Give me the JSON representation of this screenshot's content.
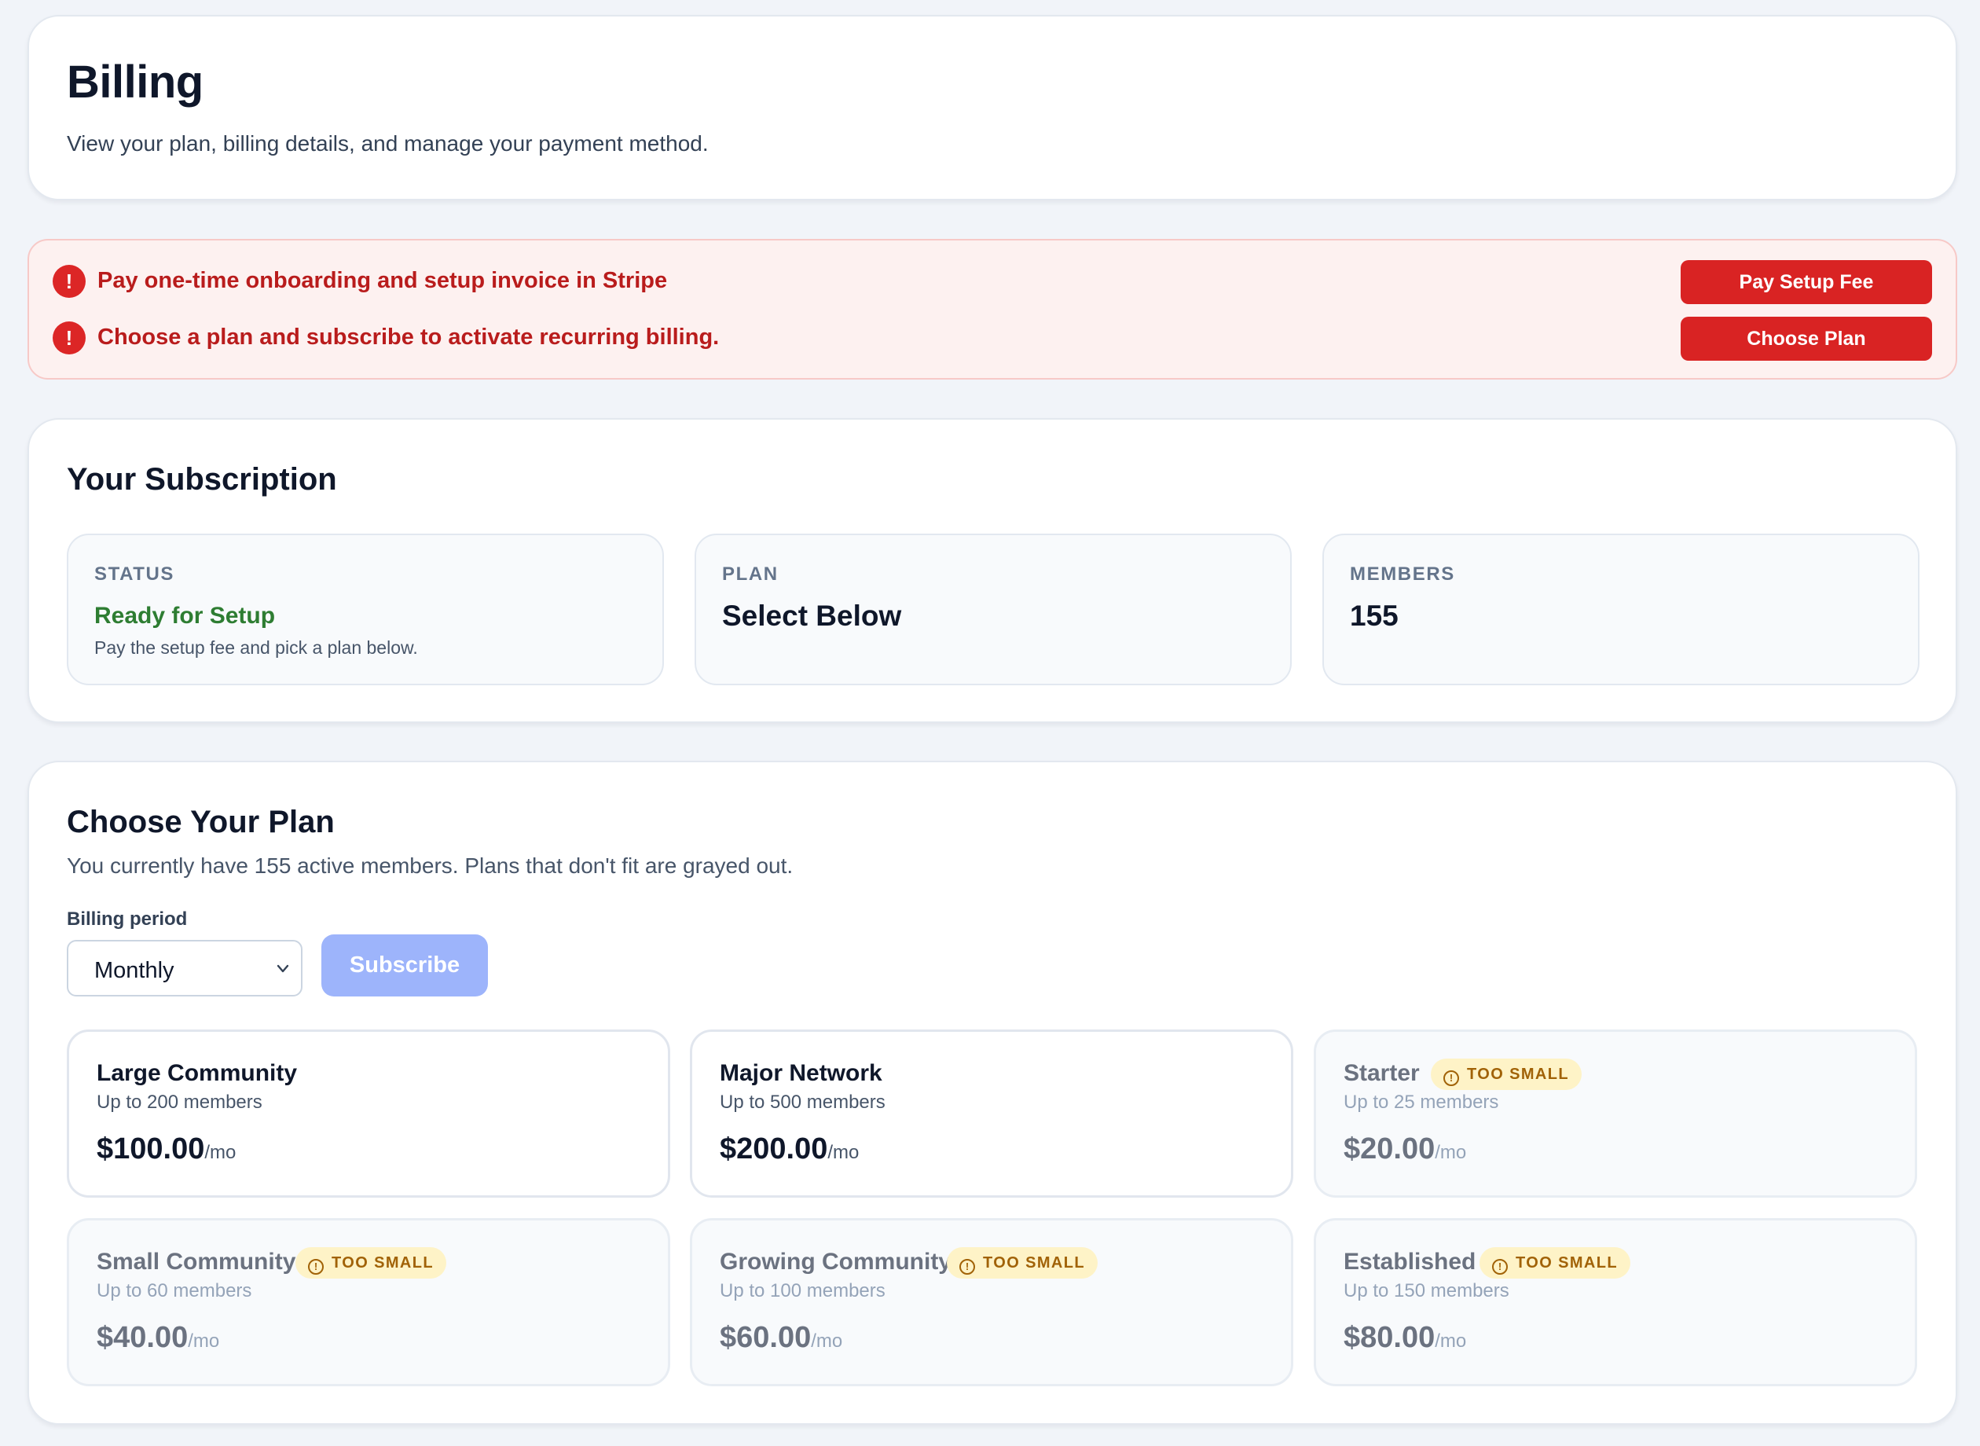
{
  "header": {
    "title": "Billing",
    "subtitle": "View your plan, billing details, and manage your payment method."
  },
  "alerts": [
    {
      "icon": "exclamation-icon",
      "text": "Pay one-time onboarding and setup invoice in Stripe",
      "button": "Pay Setup Fee"
    },
    {
      "icon": "exclamation-icon",
      "text": "Choose a plan and subscribe to activate recurring billing.",
      "button": "Choose Plan"
    }
  ],
  "subscription": {
    "title": "Your Subscription",
    "status": {
      "label": "STATUS",
      "value": "Ready for Setup",
      "note": "Pay the setup fee and pick a plan below."
    },
    "plan": {
      "label": "PLAN",
      "value": "Select Below"
    },
    "members": {
      "label": "MEMBERS",
      "value": "155"
    }
  },
  "plans": {
    "title": "Choose Your Plan",
    "description": "You currently have 155 active members. Plans that don't fit are grayed out.",
    "billing_period_label": "Billing period",
    "billing_period_value": "Monthly",
    "subscribe_label": "Subscribe",
    "unit": "/mo",
    "badge_label": "TOO SMALL",
    "items": [
      {
        "name": "Large Community",
        "members": "Up to 200 members",
        "price": "$100.00",
        "fits": true
      },
      {
        "name": "Major Network",
        "members": "Up to 500 members",
        "price": "$200.00",
        "fits": true
      },
      {
        "name": "Starter",
        "members": "Up to 25 members",
        "price": "$20.00",
        "fits": false
      },
      {
        "name": "Small Community",
        "members": "Up to 60 members",
        "price": "$40.00",
        "fits": false
      },
      {
        "name": "Growing Community",
        "members": "Up to 100 members",
        "price": "$60.00",
        "fits": false
      },
      {
        "name": "Established",
        "members": "Up to 150 members",
        "price": "$80.00",
        "fits": false
      }
    ]
  },
  "colors": {
    "background": "#f1f4f9",
    "alert_red": "#d92323",
    "alert_text": "#b91c1c",
    "status_green": "#2e7d32",
    "subscribe_disabled": "#9db4fb",
    "badge_bg": "#fef3c7",
    "badge_text": "#a16207"
  }
}
